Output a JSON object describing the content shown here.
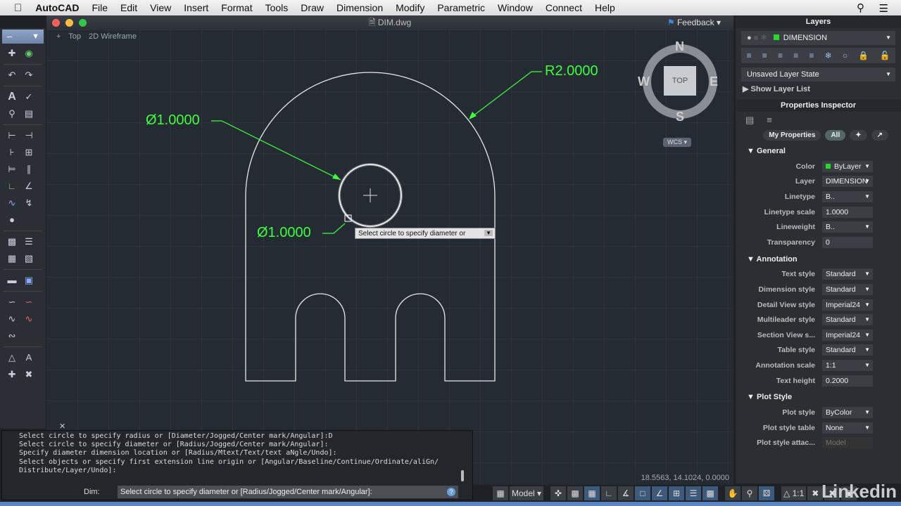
{
  "menubar": {
    "app": "AutoCAD",
    "items": [
      "File",
      "Edit",
      "View",
      "Insert",
      "Format",
      "Tools",
      "Draw",
      "Dimension",
      "Modify",
      "Parametric",
      "Window",
      "Connect",
      "Help"
    ]
  },
  "window": {
    "title": "DIM.dwg",
    "feedback": "Feedback"
  },
  "viewport": {
    "view": "Top",
    "style": "2D Wireframe",
    "plus": "+"
  },
  "viewcube": {
    "n": "N",
    "s": "S",
    "e": "E",
    "w": "W",
    "face": "TOP",
    "wcs": "WCS"
  },
  "dimensions": {
    "dia1": "Ø1.0000",
    "dia2": "Ø1.0000",
    "radius": "R2.0000"
  },
  "tooltip": "Select circle to specify diameter or",
  "coords": "18.5563, 14.1024, 0.0000",
  "command": {
    "history": [
      "Select circle to specify radius or [Diameter/Jogged/Center mark/Angular]:D",
      "Select circle to specify diameter or [Radius/Jogged/Center mark/Angular]:",
      "Specify diameter dimension location or [Radius/Mtext/Text/text aNgle/Undo]:",
      "Select objects or specify first extension line origin or [Angular/Baseline/Continue/Ordinate/aliGn/",
      "Distribute/Layer/Undo]:"
    ],
    "prompt_label": "Dim:",
    "input": "Select circle to specify diameter or [Radius/Jogged/Center mark/Angular]:"
  },
  "status": {
    "model": "Model",
    "scale": "1:1"
  },
  "layers": {
    "title": "Layers",
    "current": "DIMENSION",
    "state": "Unsaved Layer State",
    "show_list": "Show Layer List",
    "layer_color": "#22dd22"
  },
  "properties": {
    "title": "Properties Inspector",
    "filter_my": "My Properties",
    "filter_all": "All",
    "sections": [
      {
        "name": "General",
        "rows": [
          {
            "label": "Color",
            "value": "ByLayer"
          },
          {
            "label": "Layer",
            "value": "DIMENSION"
          },
          {
            "label": "Linetype",
            "value": "B.."
          },
          {
            "label": "Linetype scale",
            "value": "1.0000"
          },
          {
            "label": "Lineweight",
            "value": "B.."
          },
          {
            "label": "Transparency",
            "value": "0"
          }
        ]
      },
      {
        "name": "Annotation",
        "rows": [
          {
            "label": "Text style",
            "value": "Standard"
          },
          {
            "label": "Dimension style",
            "value": "Standard"
          },
          {
            "label": "Detail View style",
            "value": "Imperial24"
          },
          {
            "label": "Multileader style",
            "value": "Standard"
          },
          {
            "label": "Section View s...",
            "value": "Imperial24"
          },
          {
            "label": "Table style",
            "value": "Standard"
          },
          {
            "label": "Annotation scale",
            "value": "1:1"
          },
          {
            "label": "Text height",
            "value": "0.2000"
          }
        ]
      },
      {
        "name": "Plot Style",
        "rows": [
          {
            "label": "Plot style",
            "value": "ByColor"
          },
          {
            "label": "Plot style table",
            "value": "None"
          },
          {
            "label": "Plot style attac...",
            "value": "Model"
          }
        ]
      }
    ]
  },
  "watermark": "Linkedin",
  "colors": {
    "dimension": "#3aff3a",
    "canvas": "#252b33"
  }
}
